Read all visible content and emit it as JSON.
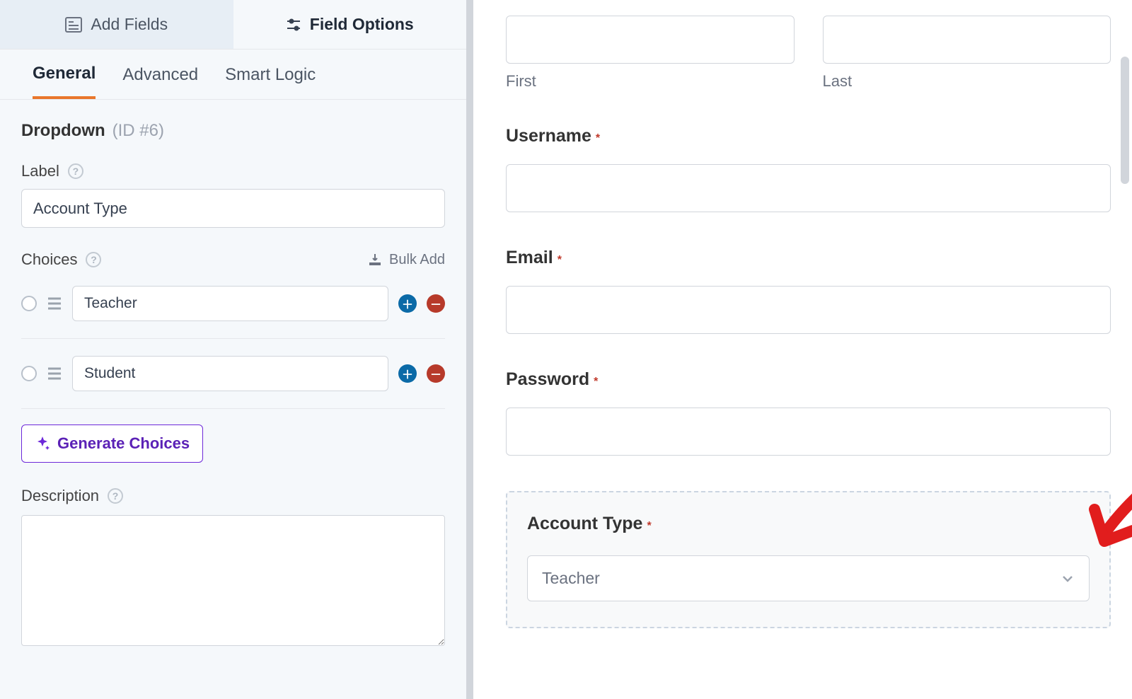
{
  "topTabs": {
    "addFields": "Add Fields",
    "fieldOptions": "Field Options"
  },
  "subTabs": {
    "general": "General",
    "advanced": "Advanced",
    "smartLogic": "Smart Logic"
  },
  "fieldType": "Dropdown",
  "fieldId": "(ID #6)",
  "labelLabel": "Label",
  "labelValue": "Account Type",
  "choicesLabel": "Choices",
  "bulkAdd": "Bulk Add",
  "choices": [
    "Teacher",
    "Student"
  ],
  "generateChoices": "Generate Choices",
  "descriptionLabel": "Description",
  "preview": {
    "first": "First",
    "last": "Last",
    "username": "Username",
    "email": "Email",
    "password": "Password",
    "accountType": "Account Type",
    "selected": "Teacher"
  }
}
